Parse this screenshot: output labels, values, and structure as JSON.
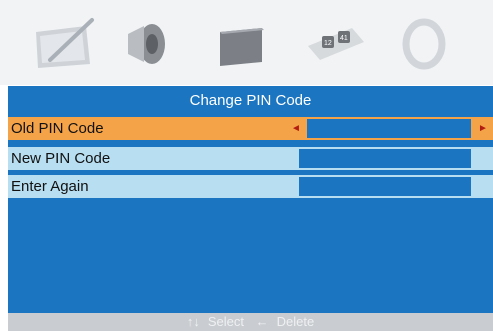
{
  "menu_icons": [
    {
      "name": "picture-icon"
    },
    {
      "name": "sound-icon"
    },
    {
      "name": "screen-icon"
    },
    {
      "name": "time-icon"
    },
    {
      "name": "setup-icon"
    }
  ],
  "dialog": {
    "title": "Change PIN Code",
    "rows": [
      {
        "label": "Old PIN Code",
        "value": "",
        "selected": true
      },
      {
        "label": "New PIN Code",
        "value": "",
        "selected": false
      },
      {
        "label": "Enter Again",
        "value": "",
        "selected": false
      }
    ]
  },
  "nav": {
    "left_arrow": "◄",
    "right_arrow": "►"
  },
  "footer": {
    "select_icon": "↑↓",
    "select_label": "Select",
    "delete_icon": "←",
    "delete_label": "Delete"
  },
  "colors": {
    "panel": "#1b75c0",
    "row": "#b7def1",
    "row_selected": "#f5a349",
    "arrow": "#b21d12"
  }
}
